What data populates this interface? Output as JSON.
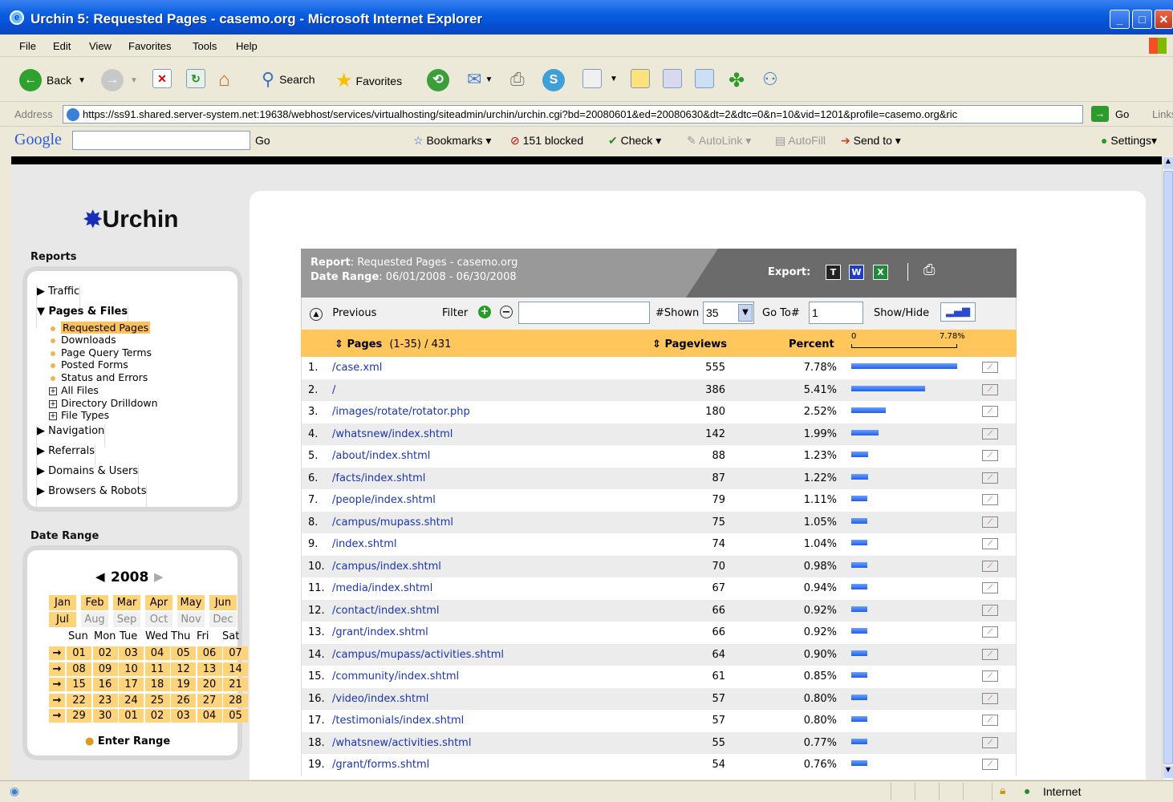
{
  "window": {
    "title": "Urchin 5: Requested Pages - casemo.org - Microsoft Internet Explorer",
    "min": "_",
    "max": "□",
    "close": "✕"
  },
  "menu": [
    "File",
    "Edit",
    "View",
    "Favorites",
    "Tools",
    "Help"
  ],
  "toolbar": {
    "back": "Back",
    "search": "Search",
    "favorites": "Favorites"
  },
  "address": {
    "label": "Address",
    "url": "https://ss91.shared.server-system.net:19638/webhost/services/virtualhosting/siteadmin/urchin/urchin.cgi?bd=20080601&ed=20080630&dt=2&dtc=0&n=10&vid=1201&profile=casemo.org&ric",
    "go": "Go",
    "links": "Links"
  },
  "google": {
    "logo": "Google",
    "go": "Go",
    "bookmarks": "Bookmarks",
    "blocked": "151 blocked",
    "check": "Check",
    "autolink": "AutoLink",
    "autofill": "AutoFill",
    "sendto": "Send to",
    "settings": "Settings"
  },
  "sidebar": {
    "logo": "Urchin",
    "reports_title": "Reports",
    "nav": [
      {
        "label": "Traffic",
        "marker": "▶"
      },
      {
        "label": "Pages & Files",
        "marker": "▼"
      },
      {
        "label": "Navigation",
        "marker": "▶"
      },
      {
        "label": "Referrals",
        "marker": "▶"
      },
      {
        "label": "Domains & Users",
        "marker": "▶"
      },
      {
        "label": "Browsers & Robots",
        "marker": "▶"
      }
    ],
    "sub": [
      {
        "label": "Requested Pages",
        "type": "dot",
        "selected": true
      },
      {
        "label": "Downloads",
        "type": "dot"
      },
      {
        "label": "Page Query Terms",
        "type": "dot"
      },
      {
        "label": "Posted Forms",
        "type": "dot"
      },
      {
        "label": "Status and Errors",
        "type": "dot"
      },
      {
        "label": "All Files",
        "type": "plus"
      },
      {
        "label": "Directory Drilldown",
        "type": "plus"
      },
      {
        "label": "File Types",
        "type": "plus"
      }
    ],
    "date_title": "Date Range",
    "year": "2008",
    "months": [
      "Jan",
      "Feb",
      "Mar",
      "Apr",
      "May",
      "Jun",
      "Jul",
      "Aug",
      "Sep",
      "Oct",
      "Nov",
      "Dec"
    ],
    "dow": [
      "Sun",
      "Mon",
      "Tue",
      "Wed",
      "Thu",
      "Fri",
      "Sat"
    ],
    "weeks": [
      [
        "01",
        "02",
        "03",
        "04",
        "05",
        "06",
        "07"
      ],
      [
        "08",
        "09",
        "10",
        "11",
        "12",
        "13",
        "14"
      ],
      [
        "15",
        "16",
        "17",
        "18",
        "19",
        "20",
        "21"
      ],
      [
        "22",
        "23",
        "24",
        "25",
        "26",
        "27",
        "28"
      ],
      [
        "29",
        "30",
        "01",
        "02",
        "03",
        "04",
        "05"
      ]
    ],
    "enter_range": "Enter Range"
  },
  "report": {
    "label_report": "Report",
    "name": ": Requested Pages - casemo.org",
    "label_range": "Date Range",
    "range": ": 06/01/2008 - 06/30/2008",
    "export": "Export:",
    "previous": "Previous",
    "filter": "Filter",
    "shown_label": "#Shown",
    "shown_value": "35",
    "goto_label": "Go To#",
    "goto_value": "1",
    "showhide": "Show/Hide",
    "col_pages": "Pages",
    "col_pages_range": "(1-35) / 431",
    "col_pageviews": "Pageviews",
    "col_percent": "Percent",
    "scale_min": "0",
    "scale_max": "7.78%",
    "max_percent": 7.78,
    "rows": [
      {
        "n": "1.",
        "page": "/case.xml",
        "views": "555",
        "pct": "7.78%",
        "v": 7.78
      },
      {
        "n": "2.",
        "page": "/",
        "views": "386",
        "pct": "5.41%",
        "v": 5.41
      },
      {
        "n": "3.",
        "page": "/images/rotate/rotator.php",
        "views": "180",
        "pct": "2.52%",
        "v": 2.52
      },
      {
        "n": "4.",
        "page": "/whatsnew/index.shtml",
        "views": "142",
        "pct": "1.99%",
        "v": 1.99
      },
      {
        "n": "5.",
        "page": "/about/index.shtml",
        "views": "88",
        "pct": "1.23%",
        "v": 1.23
      },
      {
        "n": "6.",
        "page": "/facts/index.shtml",
        "views": "87",
        "pct": "1.22%",
        "v": 1.22
      },
      {
        "n": "7.",
        "page": "/people/index.shtml",
        "views": "79",
        "pct": "1.11%",
        "v": 1.11
      },
      {
        "n": "8.",
        "page": "/campus/mupass.shtml",
        "views": "75",
        "pct": "1.05%",
        "v": 1.05
      },
      {
        "n": "9.",
        "page": "/index.shtml",
        "views": "74",
        "pct": "1.04%",
        "v": 1.04
      },
      {
        "n": "10.",
        "page": "/campus/index.shtml",
        "views": "70",
        "pct": "0.98%",
        "v": 0.98
      },
      {
        "n": "11.",
        "page": "/media/index.shtml",
        "views": "67",
        "pct": "0.94%",
        "v": 0.94
      },
      {
        "n": "12.",
        "page": "/contact/index.shtml",
        "views": "66",
        "pct": "0.92%",
        "v": 0.92
      },
      {
        "n": "13.",
        "page": "/grant/index.shtml",
        "views": "66",
        "pct": "0.92%",
        "v": 0.92
      },
      {
        "n": "14.",
        "page": "/campus/mupass/activities.shtml",
        "views": "64",
        "pct": "0.90%",
        "v": 0.9
      },
      {
        "n": "15.",
        "page": "/community/index.shtml",
        "views": "61",
        "pct": "0.85%",
        "v": 0.85
      },
      {
        "n": "16.",
        "page": "/video/index.shtml",
        "views": "57",
        "pct": "0.80%",
        "v": 0.8
      },
      {
        "n": "17.",
        "page": "/testimonials/index.shtml",
        "views": "57",
        "pct": "0.80%",
        "v": 0.8
      },
      {
        "n": "18.",
        "page": "/whatsnew/activities.shtml",
        "views": "55",
        "pct": "0.77%",
        "v": 0.77
      },
      {
        "n": "19.",
        "page": "/grant/forms.shtml",
        "views": "54",
        "pct": "0.76%",
        "v": 0.76
      }
    ]
  },
  "status": {
    "zone": "Internet"
  },
  "colors": {
    "accent_orange": "#ffc65c",
    "link_blue": "#1a35b0",
    "bar_blue": "#1f5fe8"
  }
}
